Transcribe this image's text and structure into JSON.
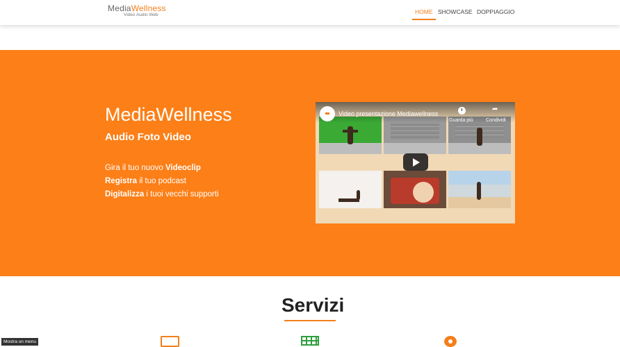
{
  "header": {
    "logo": {
      "part1": "Media",
      "part2": "Wellness",
      "tagline": "Video Audio Web"
    },
    "nav": {
      "home": "HOME",
      "showcase": "SHOWCASE",
      "doppiaggio": "DOPPIAGGIO"
    }
  },
  "hero": {
    "title": "MediaWellness",
    "subtitle": "Audio Foto Video",
    "line1": {
      "pre": "Gira il tuo nuovo ",
      "bold": "Videoclip",
      "post": ""
    },
    "line2": {
      "pre": "",
      "bold": "Registra",
      "post": " il tuo podcast"
    },
    "line3": {
      "pre": "",
      "bold": "Digitalizza",
      "post": " i tuoi vecchi supporti"
    },
    "video": {
      "title": "Video presentazione Mediawellness",
      "watch_later": "Guarda più",
      "share": "Condividi"
    }
  },
  "servizi": {
    "title": "Servizi"
  },
  "tooltip": {
    "menu": "Mostra un menu"
  },
  "colors": {
    "accent": "#f47f1a",
    "hero_bg": "#fc7f17",
    "green": "#2e9e3e"
  }
}
